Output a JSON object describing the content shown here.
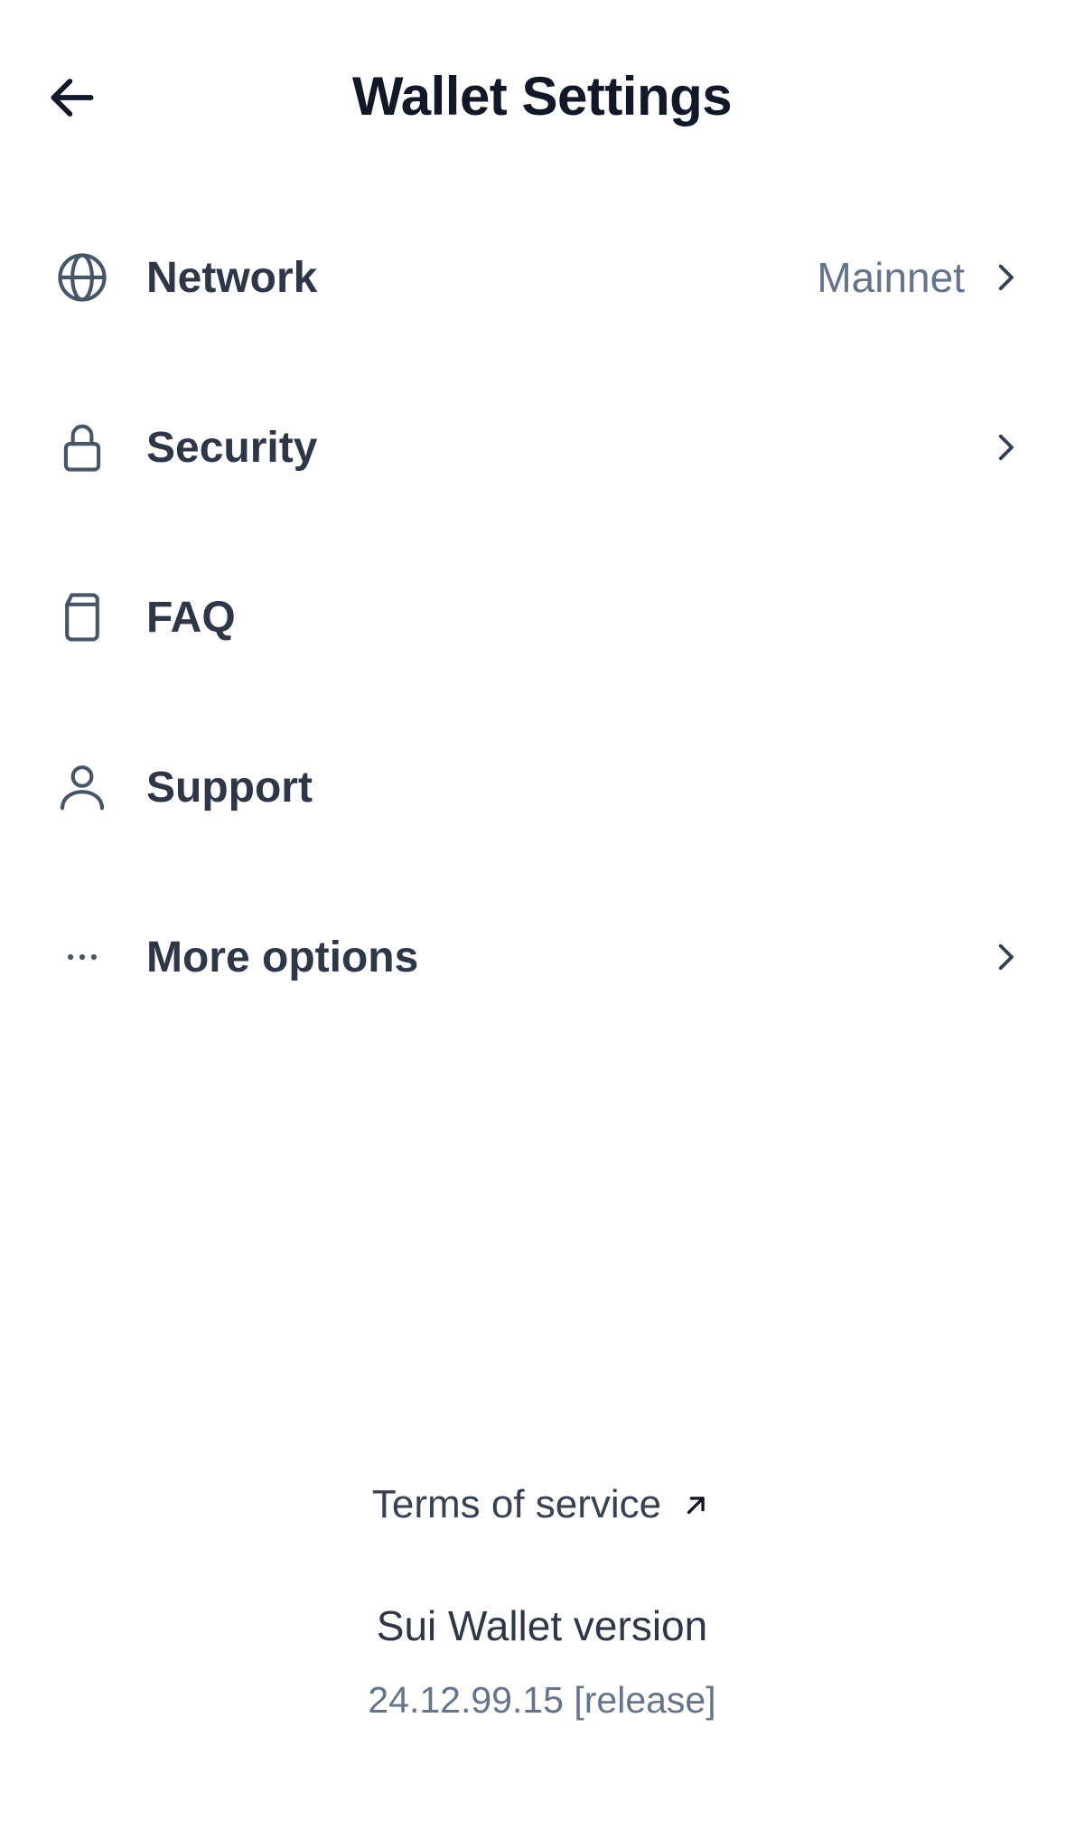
{
  "header": {
    "title": "Wallet Settings"
  },
  "menu": {
    "items": [
      {
        "label": "Network",
        "value": "Mainnet",
        "icon": "globe-icon"
      },
      {
        "label": "Security",
        "icon": "lock-icon"
      },
      {
        "label": "FAQ",
        "icon": "document-icon"
      },
      {
        "label": "Support",
        "icon": "user-icon"
      },
      {
        "label": "More options",
        "icon": "ellipsis-icon"
      }
    ]
  },
  "footer": {
    "terms_label": "Terms of service",
    "version_title": "Sui Wallet version",
    "version_number": "24.12.99.15 [release]"
  },
  "colors": {
    "text_primary": "#111827",
    "text_secondary": "#64748b",
    "icon": "#475569",
    "background": "#ffffff"
  }
}
